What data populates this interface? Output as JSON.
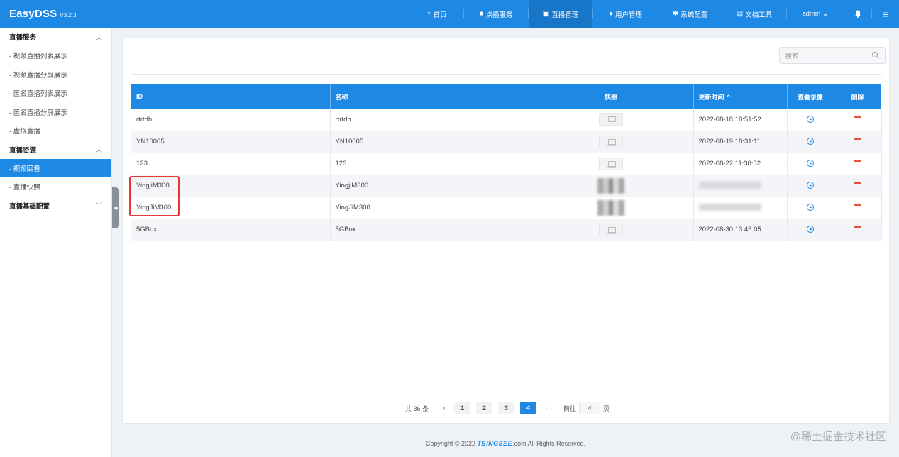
{
  "brand": {
    "name": "EasyDSS",
    "version": "V3.2.3"
  },
  "nav": {
    "home": "首页",
    "vod": "点播服务",
    "live": "直播管理",
    "users": "用户管理",
    "system": "系统配置",
    "docs": "文档工具",
    "admin": "admin"
  },
  "sidebar": {
    "groups": [
      {
        "label": "直播服务",
        "items": [
          "- 视频直播列表展示",
          "- 视频直播分屏展示",
          "- 匿名直播列表展示",
          "- 匿名直播分屏展示",
          "- 虚拟直播"
        ]
      },
      {
        "label": "直播资源",
        "items": [
          "- 视频回看",
          "- 直播快照"
        ]
      },
      {
        "label": "直播基础配置",
        "items": []
      }
    ],
    "active_item": "- 视频回看"
  },
  "search": {
    "placeholder": "搜索"
  },
  "table": {
    "headers": {
      "id": "ID",
      "name": "名称",
      "snapshot": "快照",
      "updated": "更新时间",
      "view": "查看录像",
      "delete": "删除"
    },
    "sort_indicator": "⌃",
    "rows": [
      {
        "id": "rtrtdh",
        "name": "rtrtdh",
        "updated": "2022-08-18 18:51:52"
      },
      {
        "id": "YN10005",
        "name": "YN10005",
        "updated": "2022-08-19 18:31:11"
      },
      {
        "id": "123",
        "name": "123",
        "updated": "2022-08-22 11:30:32"
      },
      {
        "id": "YingjiM300",
        "name": "YingjiM300",
        "updated": ""
      },
      {
        "id": "YingJiM300",
        "name": "YingJiM300",
        "updated": ""
      },
      {
        "id": "5GBox",
        "name": "5GBox",
        "updated": "2022-08-30 13:45:05"
      }
    ]
  },
  "pagination": {
    "total": "共 36 条",
    "pages": [
      "1",
      "2",
      "3",
      "4"
    ],
    "current": "4",
    "goto_label": "前往",
    "goto_value": "4",
    "page_unit": "页"
  },
  "footer": {
    "prefix": "Copyright © 2022 ",
    "brand": "TSINGSEE",
    "suffix": ".com All Rights Reserved."
  },
  "watermark": "@稀土掘金技术社区",
  "colors": {
    "primary": "#1e88e5",
    "danger": "#e5533d",
    "highlight_box": "#e53935"
  }
}
